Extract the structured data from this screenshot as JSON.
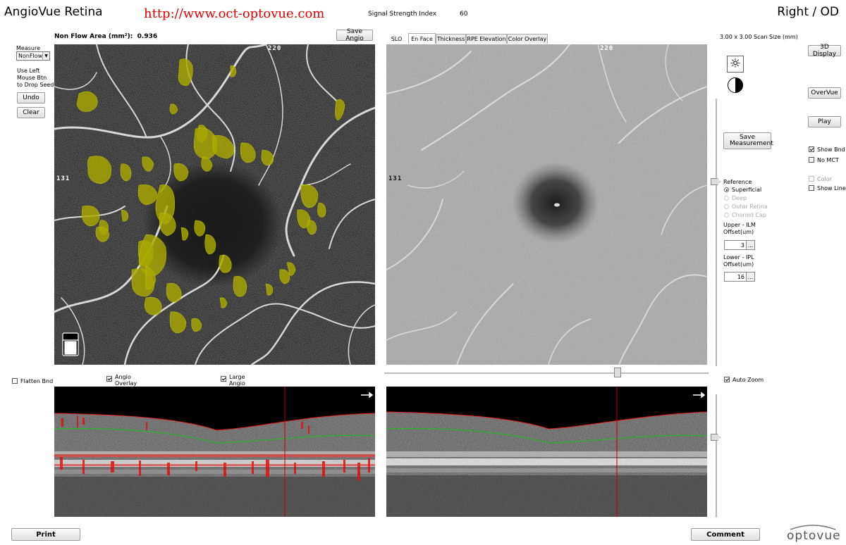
{
  "header": {
    "app_title": "AngioVue Retina",
    "url": "http://www.oct-optovue.com",
    "signal_label": "Signal Strength Index",
    "signal_value": "60",
    "eye": "Right / OD"
  },
  "left_tools": {
    "measure_label": "Measure",
    "measure_select": "NonFlow",
    "instructions": [
      "Use Left",
      "Mouse Btn",
      "to Drop Seed"
    ],
    "undo": "Undo",
    "clear": "Clear"
  },
  "angio_panel": {
    "nonflow_label": "Non Flow Area (mm²):",
    "nonflow_value": "0.936",
    "save_angio": "Save Angio",
    "top_label": "220",
    "left_label": "131"
  },
  "enface_panel": {
    "tabs": [
      {
        "label": "SLO",
        "active": false
      },
      {
        "label": "En Face",
        "active": true
      },
      {
        "label": "Thickness",
        "active": false
      },
      {
        "label": "RPE Elevation",
        "active": false
      },
      {
        "label": "Color Overlay",
        "active": false
      }
    ],
    "top_label": "220",
    "left_label": "131"
  },
  "right_controls": {
    "scan_size": "3.00 x 3.00 Scan Size (mm)",
    "display_3d": "3D Display",
    "overvue": "OverVue",
    "play": "Play",
    "save_measurement": "Save Measurement",
    "show_bnd": {
      "label": "Show Bnd",
      "checked": true
    },
    "no_mct": {
      "label": "No MCT",
      "checked": false
    },
    "color": {
      "label": "Color",
      "checked": false
    },
    "show_line": {
      "label": "Show Line",
      "checked": false
    },
    "reference_label": "Reference",
    "reference_options": [
      {
        "label": "Superficial",
        "selected": true,
        "enabled": true
      },
      {
        "label": "Deep",
        "selected": false,
        "enabled": false
      },
      {
        "label": "Outer Retina",
        "selected": false,
        "enabled": false
      },
      {
        "label": "Choroid Cap",
        "selected": false,
        "enabled": false
      }
    ],
    "upper_label_1": "Upper - ILM",
    "upper_label_2": "Offset(um)",
    "upper_value": "3",
    "lower_label_1": "Lower - IPL",
    "lower_label_2": "Offset(um)",
    "lower_value": "16",
    "ellipsis": "..."
  },
  "bscan_controls": {
    "flatten_bnd": {
      "label": "Flatten Bnd",
      "checked": false
    },
    "angio_overlay": {
      "label": "Angio Overlay",
      "checked": true
    },
    "large_angio": {
      "label": "Large Angio",
      "checked": true
    },
    "auto_zoom": {
      "label": "Auto Zoom",
      "checked": true
    }
  },
  "footer": {
    "print": "Print",
    "comment": "Comment",
    "logo": "optovue"
  },
  "colors": {
    "nonflow_overlay": "#a8a800",
    "ilm_line": "#e02020",
    "ipl_line": "#20c020",
    "angio_flow": "#e01010",
    "url_color": "#e00000"
  }
}
